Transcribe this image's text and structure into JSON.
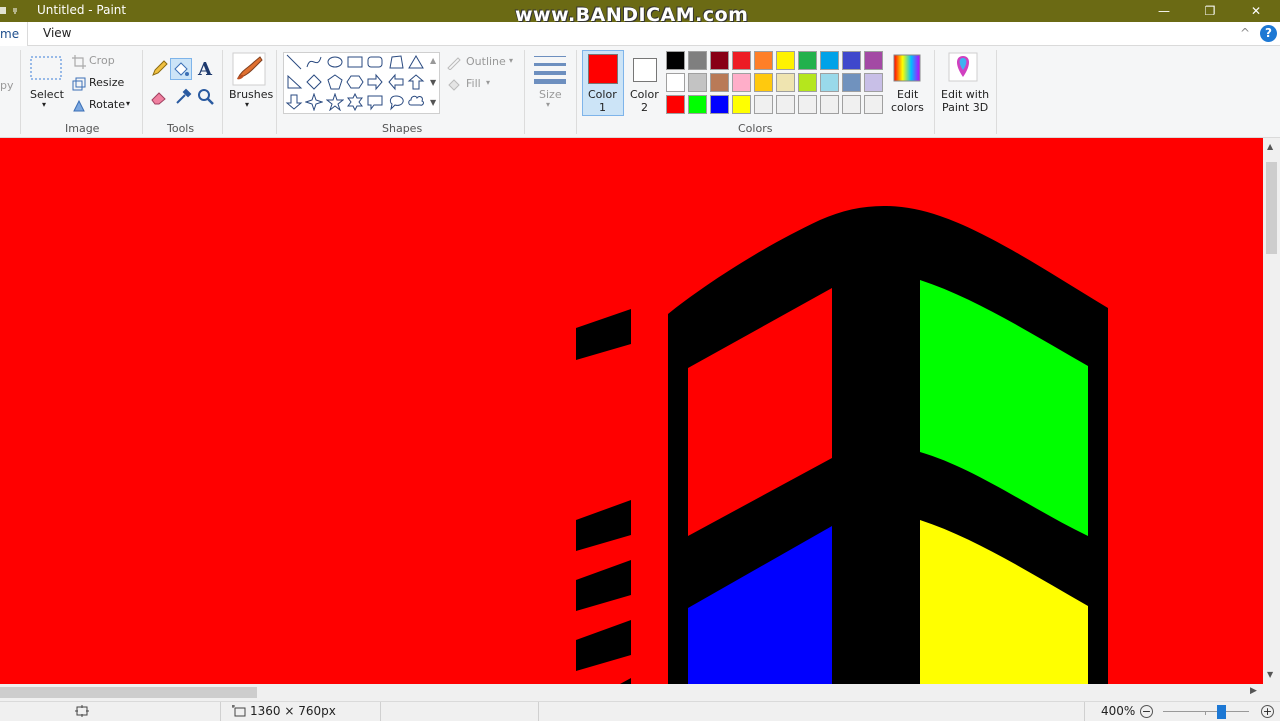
{
  "window": {
    "title": "Untitled - Paint",
    "watermark": "www.BANDICAM.com",
    "minimize": "—",
    "maximize": "❐",
    "close": "✕"
  },
  "menu": {
    "home_tab": "me",
    "view_tab": "View",
    "collapse": "^",
    "help": "?"
  },
  "ribbon": {
    "clipboard_partial": "py",
    "image": {
      "group": "Image",
      "select": "Select",
      "crop": "Crop",
      "resize": "Resize",
      "rotate": "Rotate"
    },
    "tools": {
      "group": "Tools"
    },
    "brushes": {
      "label": "Brushes"
    },
    "shapes": {
      "group": "Shapes",
      "outline": "Outline",
      "fill": "Fill"
    },
    "size": {
      "label": "Size"
    },
    "colors": {
      "group": "Colors",
      "color1_line1": "Color",
      "color1_line2": "1",
      "color2_line1": "Color",
      "color2_line2": "2",
      "edit_line1": "Edit",
      "edit_line2": "colors",
      "paint3d_line1": "Edit with",
      "paint3d_line2": "Paint 3D",
      "color1_value": "#ff0000",
      "color2_value": "#ffffff",
      "palette_rows": [
        [
          "#000000",
          "#7f7f7f",
          "#880015",
          "#ed1c24",
          "#ff7f27",
          "#fff200",
          "#22b14c",
          "#00a2e8",
          "#3f48cc",
          "#a349a4"
        ],
        [
          "#ffffff",
          "#c3c3c3",
          "#b97a57",
          "#ffaec9",
          "#ffc90e",
          "#efe4b0",
          "#b5e61d",
          "#99d9ea",
          "#7092be",
          "#c8bfe7"
        ],
        [
          "#ff0000",
          "#00ff00",
          "#0000ff",
          "#ffff00",
          "#f0f0f0",
          "#f0f0f0",
          "#f0f0f0",
          "#f0f0f0",
          "#f0f0f0",
          "#f0f0f0"
        ]
      ]
    }
  },
  "canvas": {
    "background": "#ff0000",
    "logo_colors": {
      "frame": "#000000",
      "red": "#ff0000",
      "green": "#00ff00",
      "blue": "#0000ff",
      "yellow": "#ffff00"
    }
  },
  "status": {
    "dimensions": "1360 × 760px",
    "zoom": "400%",
    "zoom_out": "−",
    "zoom_in": "+"
  }
}
